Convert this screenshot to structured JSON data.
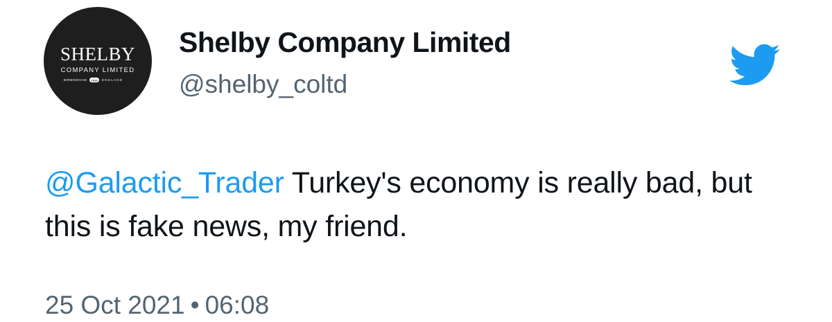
{
  "author": {
    "display_name": "Shelby Company Limited",
    "handle": "@shelby_coltd",
    "avatar": {
      "logo_main": "SHELBY",
      "logo_sub": "COMPANY LIMITED",
      "logo_left": "BIRMINGHAM",
      "logo_right": "ENGLAND",
      "logo_badge": "1919"
    }
  },
  "icons": {
    "brand": "twitter-bird-icon"
  },
  "colors": {
    "accent": "#1d9bf0",
    "text": "#0f1419",
    "secondary": "#536471",
    "avatar_bg": "#1e1e1e"
  },
  "tweet": {
    "mention": "@Galactic_Trader",
    "body": " Turkey's economy is really bad, but this is fake news, my friend.",
    "date": "25 Oct 2021",
    "separator": "•",
    "time": "06:08"
  }
}
